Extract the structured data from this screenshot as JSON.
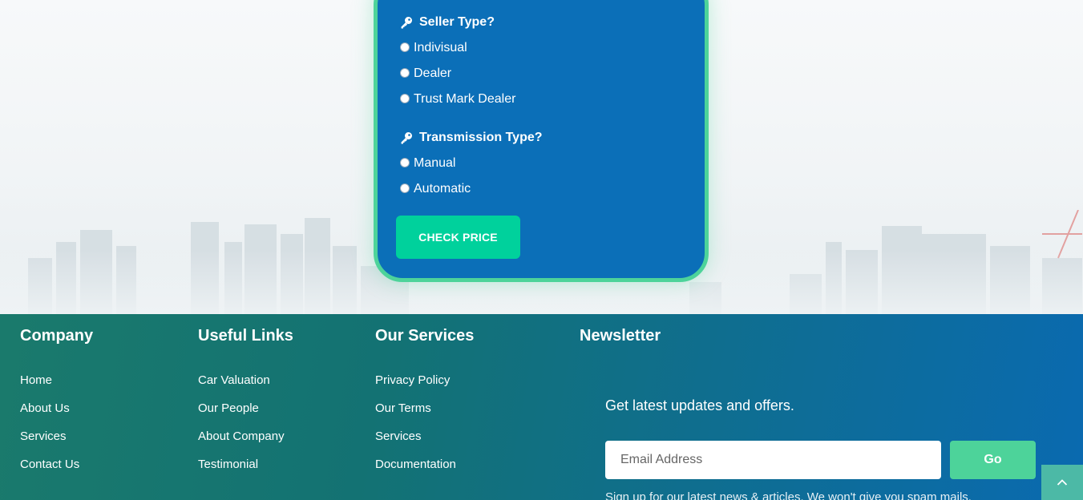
{
  "form": {
    "seller_title": "Seller Type?",
    "seller_options": [
      "Indivisual",
      "Dealer",
      "Trust Mark Dealer"
    ],
    "transmission_title": "Transmission Type?",
    "transmission_options": [
      "Manual",
      "Automatic"
    ],
    "check_button": "CHECK PRICE"
  },
  "footer": {
    "company": {
      "title": "Company",
      "links": [
        "Home",
        "About Us",
        "Services",
        "Contact Us"
      ]
    },
    "useful_links": {
      "title": "Useful Links",
      "links": [
        "Car Valuation",
        "Our People",
        "About Company",
        "Testimonial"
      ]
    },
    "our_services": {
      "title": "Our Services",
      "links": [
        "Privacy Policy",
        "Our Terms",
        "Services",
        "Documentation"
      ]
    },
    "newsletter": {
      "title": "Newsletter",
      "subtitle": "Get latest updates and offers.",
      "email_placeholder": "Email Address",
      "go_button": "Go",
      "disclaimer": "Sign up for our latest news & articles. We won't give you spam mails."
    }
  },
  "icons": {
    "key": "key-icon",
    "scroll_top": "chevron-up-icon"
  },
  "colors": {
    "card_bg": "#0b6fb8",
    "card_border": "#4dd39a",
    "check_button": "#00d19c",
    "go_button": "#4dd39a",
    "scroll_top": "#4cb9a6"
  }
}
